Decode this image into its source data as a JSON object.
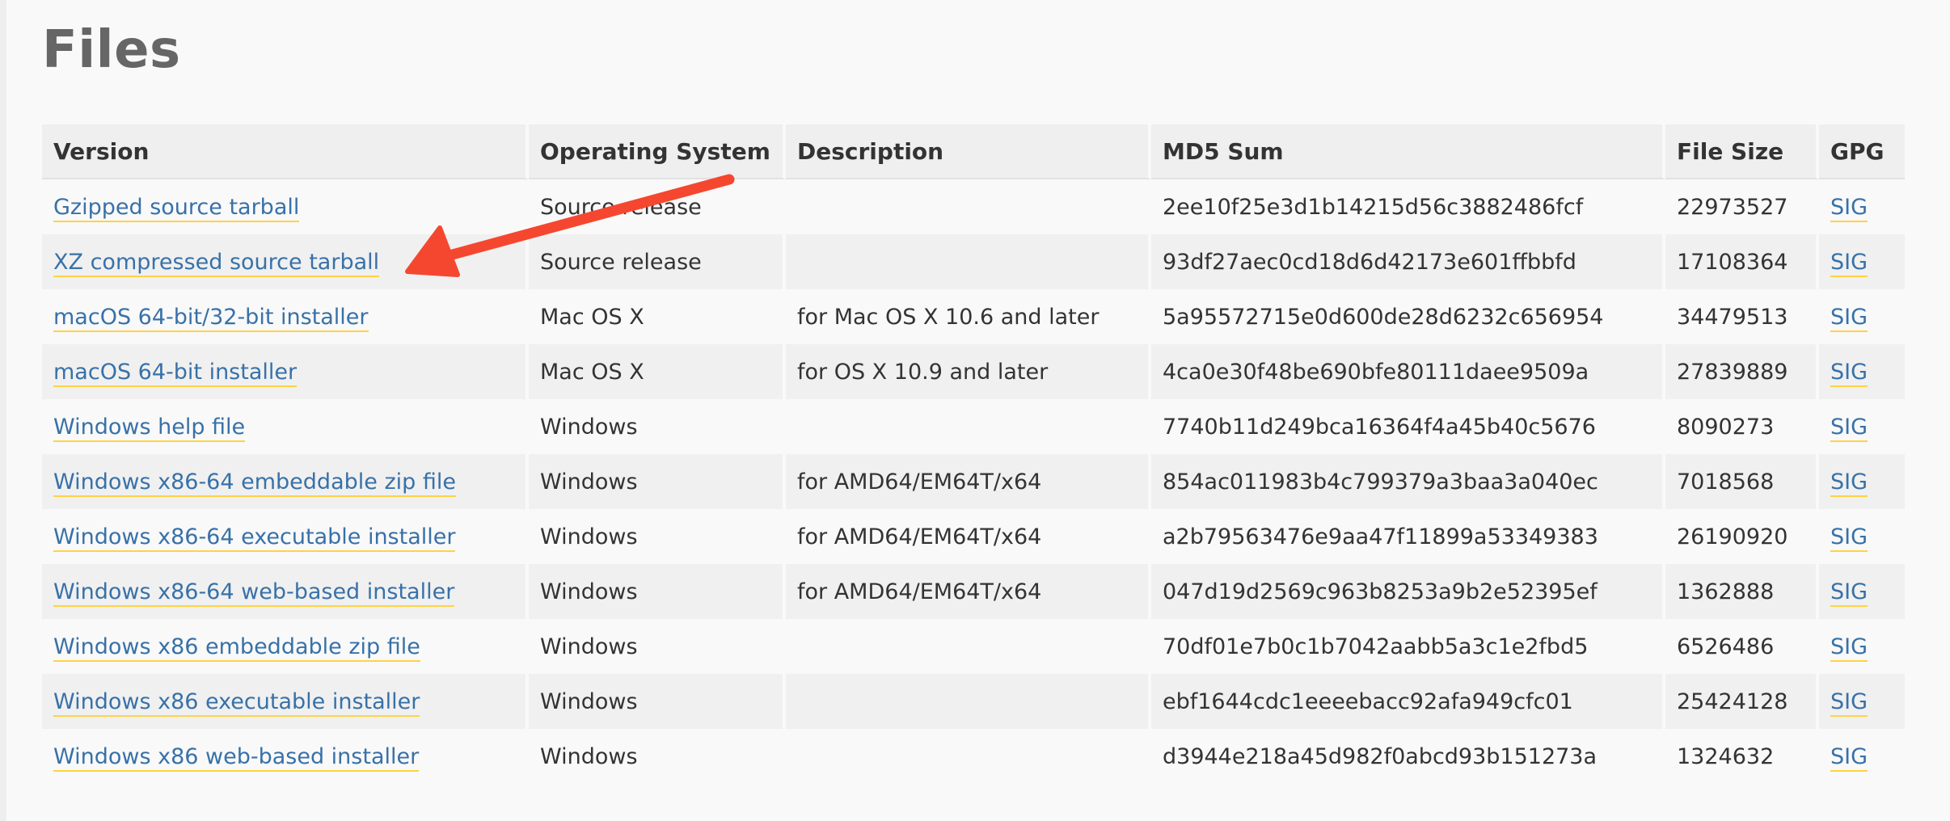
{
  "page": {
    "title": "Files"
  },
  "table": {
    "headers": {
      "version": "Version",
      "os": "Operating System",
      "description": "Description",
      "md5": "MD5 Sum",
      "size": "File Size",
      "gpg": "GPG"
    },
    "rows": [
      {
        "version": "Gzipped source tarball",
        "os": "Source release",
        "description": "",
        "md5": "2ee10f25e3d1b14215d56c3882486fcf",
        "size": "22973527",
        "gpg": "SIG"
      },
      {
        "version": "XZ compressed source tarball",
        "os": "Source release",
        "description": "",
        "md5": "93df27aec0cd18d6d42173e601ffbbfd",
        "size": "17108364",
        "gpg": "SIG"
      },
      {
        "version": "macOS 64-bit/32-bit installer",
        "os": "Mac OS X",
        "description": "for Mac OS X 10.6 and later",
        "md5": "5a95572715e0d600de28d6232c656954",
        "size": "34479513",
        "gpg": "SIG"
      },
      {
        "version": "macOS 64-bit installer",
        "os": "Mac OS X",
        "description": "for OS X 10.9 and later",
        "md5": "4ca0e30f48be690bfe80111daee9509a",
        "size": "27839889",
        "gpg": "SIG"
      },
      {
        "version": "Windows help file",
        "os": "Windows",
        "description": "",
        "md5": "7740b11d249bca16364f4a45b40c5676",
        "size": "8090273",
        "gpg": "SIG"
      },
      {
        "version": "Windows x86-64 embeddable zip file",
        "os": "Windows",
        "description": "for AMD64/EM64T/x64",
        "md5": "854ac011983b4c799379a3baa3a040ec",
        "size": "7018568",
        "gpg": "SIG"
      },
      {
        "version": "Windows x86-64 executable installer",
        "os": "Windows",
        "description": "for AMD64/EM64T/x64",
        "md5": "a2b79563476e9aa47f11899a53349383",
        "size": "26190920",
        "gpg": "SIG"
      },
      {
        "version": "Windows x86-64 web-based installer",
        "os": "Windows",
        "description": "for AMD64/EM64T/x64",
        "md5": "047d19d2569c963b8253a9b2e52395ef",
        "size": "1362888",
        "gpg": "SIG"
      },
      {
        "version": "Windows x86 embeddable zip file",
        "os": "Windows",
        "description": "",
        "md5": "70df01e7b0c1b7042aabb5a3c1e2fbd5",
        "size": "6526486",
        "gpg": "SIG"
      },
      {
        "version": "Windows x86 executable installer",
        "os": "Windows",
        "description": "",
        "md5": "ebf1644cdc1eeeebacc92afa949cfc01",
        "size": "25424128",
        "gpg": "SIG"
      },
      {
        "version": "Windows x86 web-based installer",
        "os": "Windows",
        "description": "",
        "md5": "d3944e218a45d982f0abcd93b151273a",
        "size": "1324632",
        "gpg": "SIG"
      }
    ]
  },
  "colors": {
    "link": "#3871a8",
    "link_underline": "#ffd343",
    "annotation_arrow": "#f5472f",
    "header_bg": "#efefef",
    "row_alt_bg": "#f0f0f0"
  },
  "annotation": {
    "icon": "arrow-annotation-icon"
  }
}
